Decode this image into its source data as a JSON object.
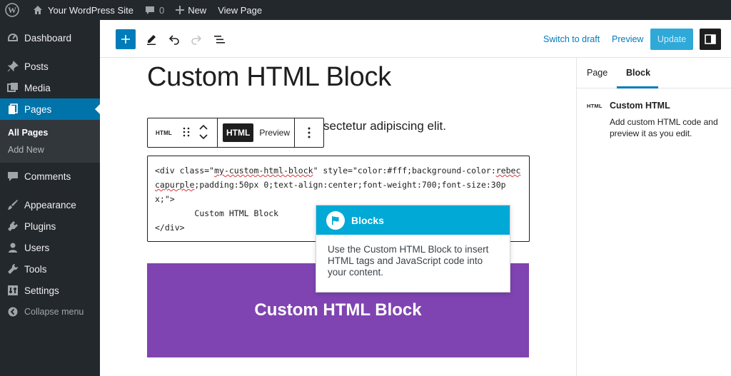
{
  "admin_bar": {
    "site_name": "Your WordPress Site",
    "comments_count": "0",
    "new_label": "New",
    "view_page_label": "View Page"
  },
  "menu": {
    "items": [
      {
        "label": "Dashboard",
        "icon": "dashboard-icon"
      },
      {
        "label": "Posts",
        "icon": "pin-icon"
      },
      {
        "label": "Media",
        "icon": "media-icon"
      },
      {
        "label": "Pages",
        "icon": "pages-icon"
      },
      {
        "label": "Comments",
        "icon": "comment-icon"
      },
      {
        "label": "Appearance",
        "icon": "brush-icon"
      },
      {
        "label": "Plugins",
        "icon": "plugin-icon"
      },
      {
        "label": "Users",
        "icon": "users-icon"
      },
      {
        "label": "Tools",
        "icon": "wrench-icon"
      },
      {
        "label": "Settings",
        "icon": "settings-icon"
      }
    ],
    "submenu": [
      "All Pages",
      "Add New"
    ],
    "collapse_label": "Collapse menu"
  },
  "header": {
    "switch_to_draft": "Switch to draft",
    "preview": "Preview",
    "update": "Update"
  },
  "editor": {
    "title": "Custom HTML Block",
    "paragraph_fragment": "sectetur adipiscing elit.",
    "toolbar": {
      "block_icon": "HTML",
      "html_tab": "HTML",
      "preview_tab": "Preview"
    },
    "code": {
      "line1_a": "<div class=\"",
      "line1_b": "my-custom-html-block",
      "line1_c": "\" style=\"color:#fff;background-color:",
      "line1_d": "rebeccapurple",
      "line1_e": ";padding:50px 0;text-align:center;font-weight:700;font-size:30px;\">",
      "line2": "        Custom HTML Block",
      "line3": "</div>"
    },
    "rendered_block_text": "Custom HTML Block"
  },
  "tooltip": {
    "title": "Blocks",
    "body": "Use the Custom HTML Block to insert HTML tags and JavaScript code into your content."
  },
  "sidebar": {
    "tabs": [
      "Page",
      "Block"
    ],
    "active_tab": "Block",
    "block_icon": "HTML",
    "block_name": "Custom HTML",
    "block_description": "Add custom HTML code and preview it as you edit."
  },
  "colors": {
    "admin_dark": "#23282d",
    "accent_blue": "#0073aa",
    "rebeccapurple": "#7f44b1",
    "tooltip_cyan": "#00a9d6"
  }
}
